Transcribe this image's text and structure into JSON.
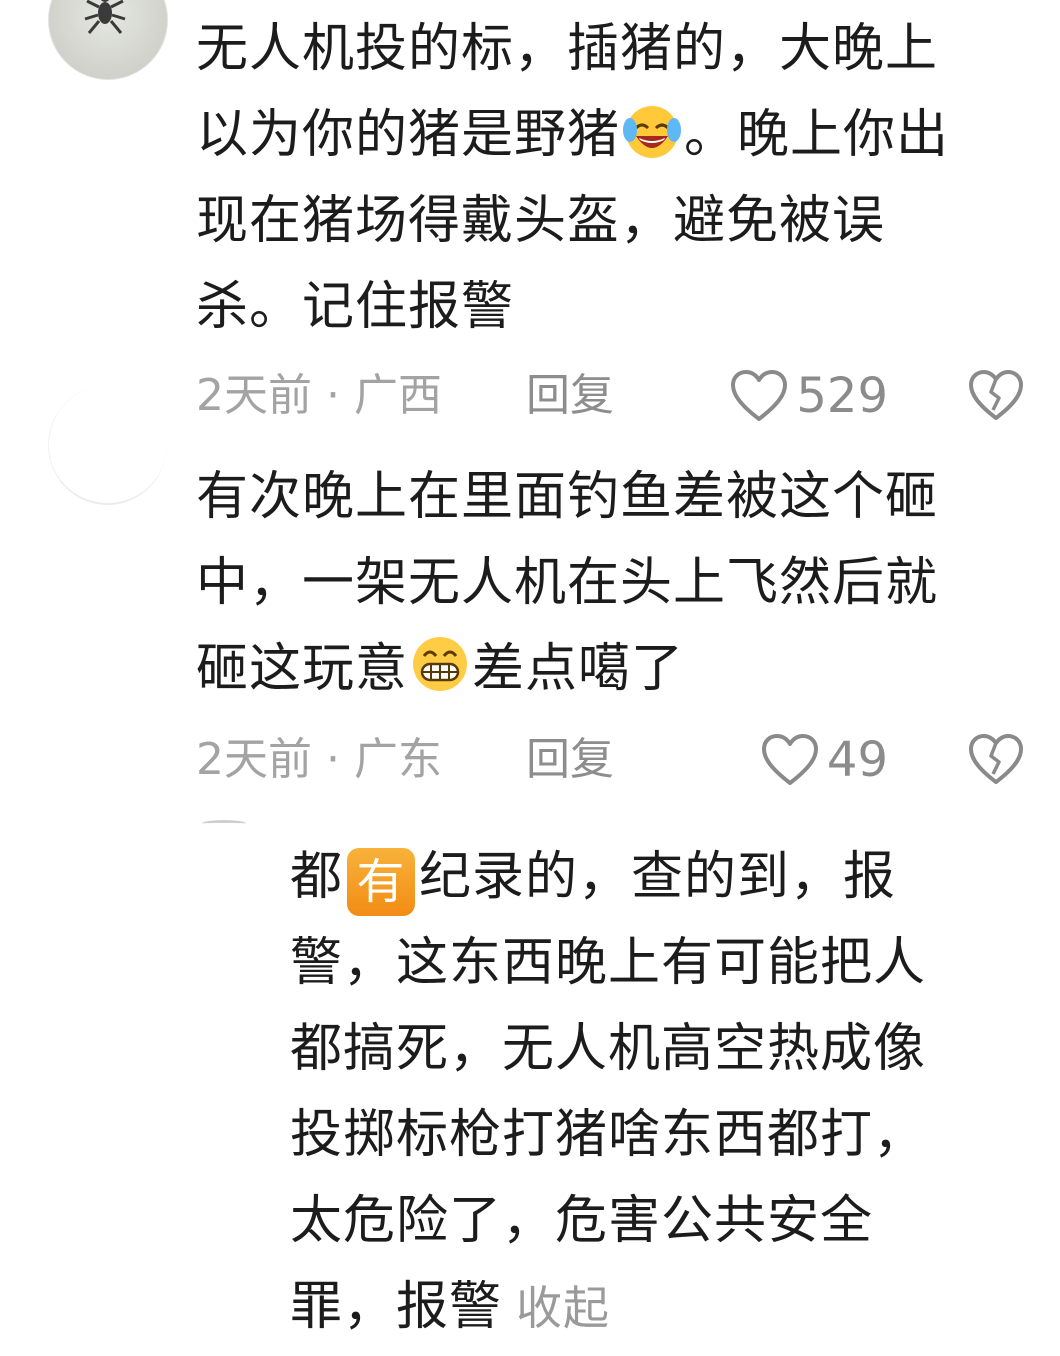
{
  "comments": [
    {
      "lines": [
        "无人机投的标，插猪的，大晚上",
        "以为你的猪是野猪",
        "。晚上你出",
        "现在猪场得戴头盔，避免被误",
        "杀。记住报警"
      ],
      "emoji": "laughing-crying-emoji",
      "time_location": "2天前 · 广西",
      "reply_label": "回复",
      "like_count": "529"
    },
    {
      "lines": [
        "有次晚上在里面钓鱼差被这个砸",
        "中，一架无人机在头上飞然后就",
        "砸这玩意",
        "差点噶了"
      ],
      "emoji": "grinning-teeth-emoji",
      "time_location": "2天前 · 广东",
      "reply_label": "回复",
      "like_count": "49"
    }
  ],
  "reply": {
    "lines": [
      "都",
      "有",
      "纪录的，查的到，报",
      "警，这东西晚上有可能把人",
      "都搞死，无人机高空热成像",
      "投掷标枪打猪啥东西都打，",
      "太危险了，危害公共安全",
      "罪，报警"
    ],
    "collapse_label": "收起"
  },
  "icons": {
    "like": "heart-outline-icon",
    "dislike": "broken-heart-icon"
  },
  "colors": {
    "text": "#1c1c1c",
    "meta": "#a3a3a3",
    "badge": "#f28c14"
  }
}
